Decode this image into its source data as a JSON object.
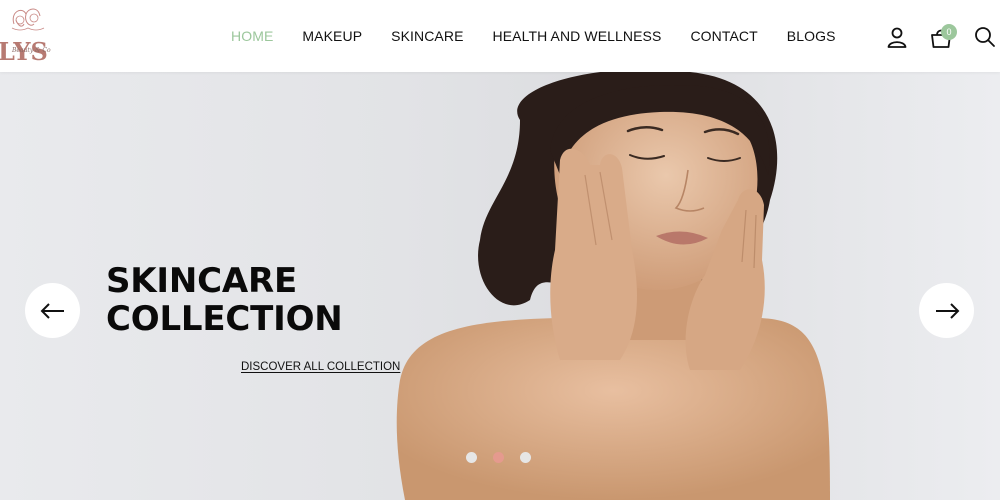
{
  "header": {
    "logo_text": "LYS",
    "logo_script": "Beauty & Co",
    "nav": [
      {
        "label": "HOME",
        "active": true
      },
      {
        "label": "MAKEUP",
        "active": false
      },
      {
        "label": "SKINCARE",
        "active": false
      },
      {
        "label": "HEALTH AND WELLNESS",
        "active": false
      },
      {
        "label": "CONTACT",
        "active": false
      },
      {
        "label": "BLOGS",
        "active": false
      }
    ],
    "icons": [
      "user-icon",
      "cart-icon",
      "search-icon"
    ],
    "cart_count": "0",
    "accent_color": "#9cc79c"
  },
  "hero": {
    "title_line1": "SKINCARE",
    "title_line2": "COLLECTION",
    "link_label": "DISCOVER ALL COLLECTION",
    "prev_icon": "arrow-left-icon",
    "next_icon": "arrow-right-icon",
    "slides_count": 3,
    "active_slide": 2,
    "active_dot_color": "#e59a8e"
  }
}
